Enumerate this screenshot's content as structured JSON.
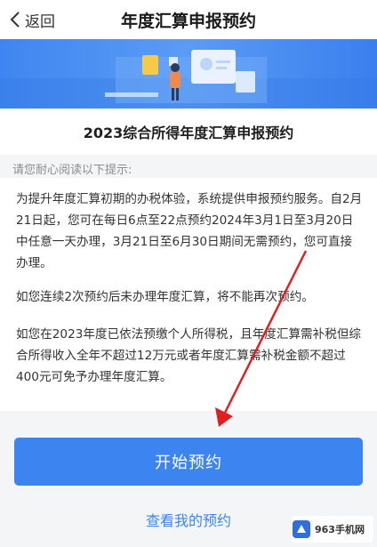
{
  "nav": {
    "back_label": "返回",
    "title": "年度汇算申报预约"
  },
  "banner": {
    "illustration": "person-with-documents-illustration"
  },
  "card": {
    "title": "2023综合所得年度汇算申报预约"
  },
  "hint": "请您耐心阅读以下提示:",
  "paragraphs": [
    "为提升年度汇算初期的办税体验，系统提供申报预约服务。自2月21日起，您可在每日6点至22点预约2024年3月1日至3月20日中任意一天办理，3月21日至6月30日期间无需预约，您可直接办理。",
    "如您连续2次预约后未办理年度汇算，将不能再次预约。",
    "如您在2023年度已依法预缴个人所得税，且年度汇算需补税但综合所得收入全年不超过12万元或者年度汇算需补税金额不超过400元可免予办理年度汇算。"
  ],
  "actions": {
    "start_label": "开始预约",
    "view_label": "查看我的预约"
  },
  "watermark": {
    "text": "963手机网"
  },
  "colors": {
    "accent": "#3c84ef",
    "banner": "#4a8ff2",
    "annotation_arrow": "#e02020"
  }
}
